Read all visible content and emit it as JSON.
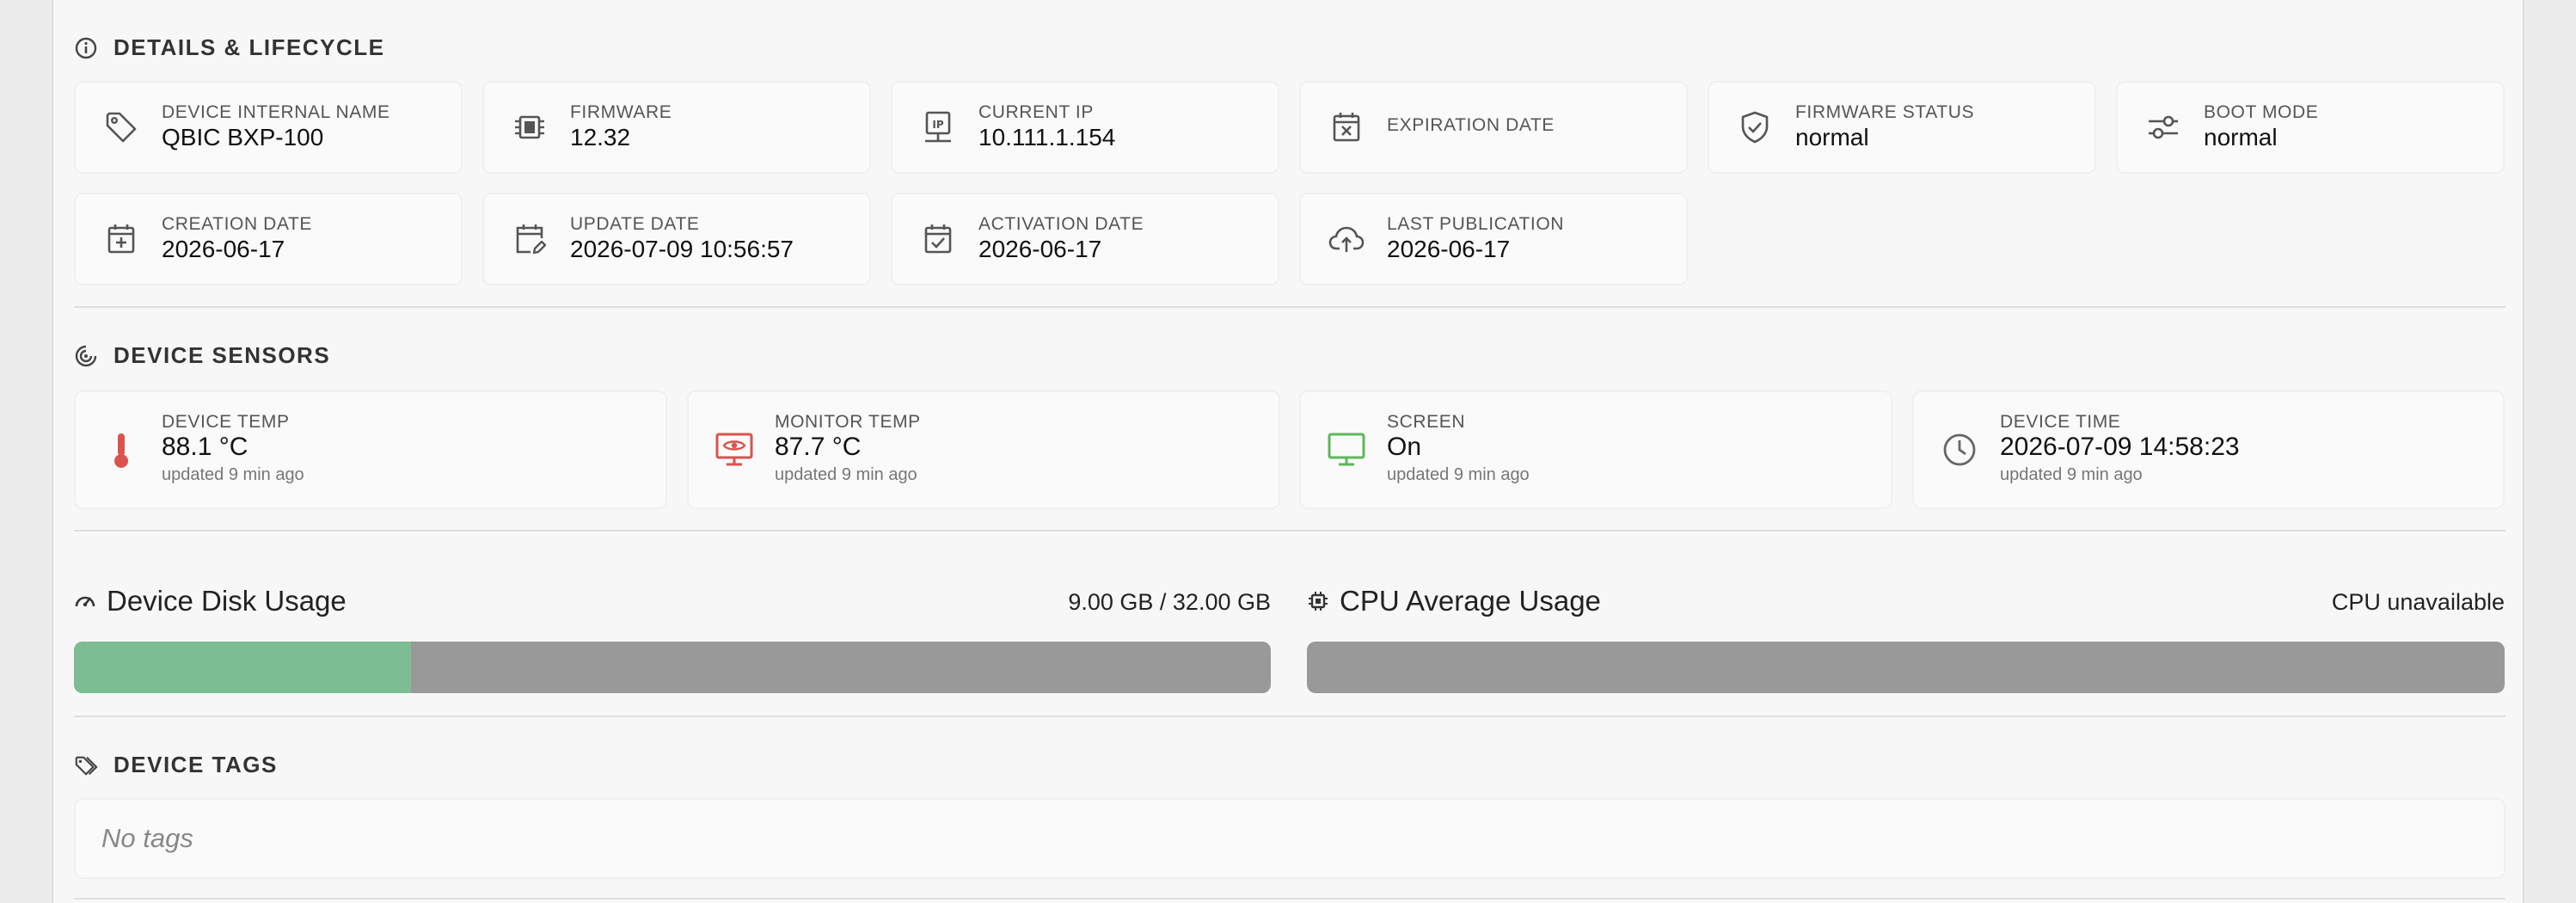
{
  "details": {
    "title": "DETAILS & LIFECYCLE",
    "cards": [
      {
        "label": "DEVICE INTERNAL NAME",
        "value": "QBIC BXP-100",
        "icon": "tag-icon"
      },
      {
        "label": "FIRMWARE",
        "value": "12.32",
        "icon": "chip-icon"
      },
      {
        "label": "CURRENT IP",
        "value": "10.111.1.154",
        "icon": "ip-icon"
      },
      {
        "label": "EXPIRATION DATE",
        "value": "",
        "icon": "calendar-x-icon"
      },
      {
        "label": "FIRMWARE STATUS",
        "value": "normal",
        "icon": "shield-check-icon"
      },
      {
        "label": "BOOT MODE",
        "value": "normal",
        "icon": "sliders-icon"
      },
      {
        "label": "CREATION DATE",
        "value": "2026-06-17",
        "icon": "calendar-plus-icon"
      },
      {
        "label": "UPDATE DATE",
        "value": "2026-07-09 10:56:57",
        "icon": "calendar-edit-icon"
      },
      {
        "label": "ACTIVATION DATE",
        "value": "2026-06-17",
        "icon": "calendar-check-icon"
      },
      {
        "label": "LAST PUBLICATION",
        "value": "2026-06-17",
        "icon": "cloud-upload-icon"
      }
    ]
  },
  "sensors": {
    "title": "DEVICE SENSORS",
    "cards": [
      {
        "label": "DEVICE TEMP",
        "value": "88.1 °C",
        "updated": "updated 9 min ago",
        "icon": "thermometer-icon",
        "color": "#d9534f"
      },
      {
        "label": "MONITOR TEMP",
        "value": "87.7 °C",
        "updated": "updated 9 min ago",
        "icon": "monitor-eye-icon",
        "color": "#d9534f"
      },
      {
        "label": "SCREEN",
        "value": "On",
        "updated": "updated 9 min ago",
        "icon": "monitor-icon",
        "color": "#5cb85c"
      },
      {
        "label": "DEVICE TIME",
        "value": "2026-07-09 14:58:23",
        "updated": "updated 9 min ago",
        "icon": "clock-icon",
        "color": "#666666"
      }
    ]
  },
  "disk": {
    "title": "Device Disk Usage",
    "summary": "9.00 GB / 32.00 GB",
    "used_gb": 9.0,
    "total_gb": 32.0,
    "fill_color": "#7dbd93"
  },
  "cpu": {
    "title": "CPU Average Usage",
    "summary": "CPU unavailable"
  },
  "tags": {
    "title": "DEVICE TAGS",
    "empty_text": "No tags"
  }
}
